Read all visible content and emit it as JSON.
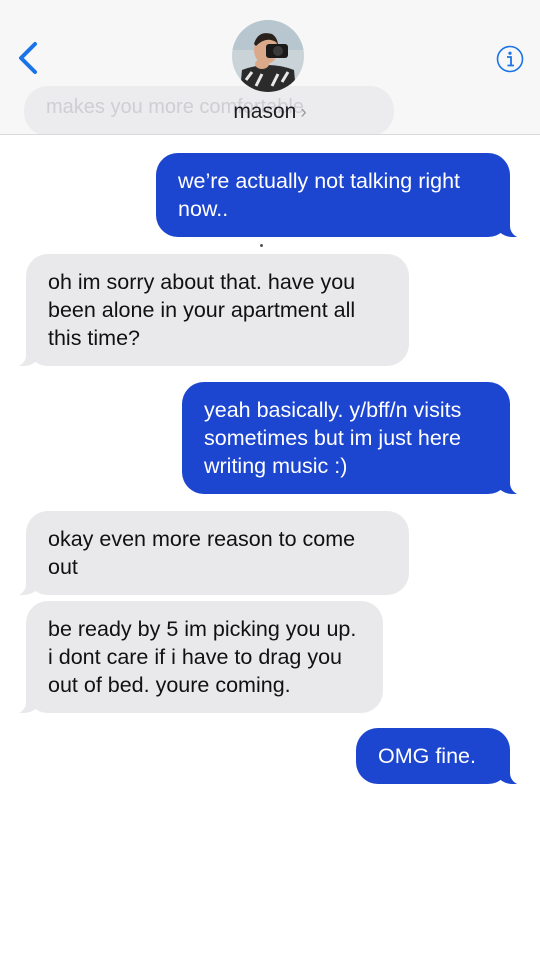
{
  "header": {
    "back_icon": "chevron-left-icon",
    "contact_name": "mason",
    "contact_chevron": "›",
    "info_icon": "info-circle-icon",
    "ghost_text": "makes you more comfortable",
    "accent_color": "#1a74e8"
  },
  "messages": [
    {
      "direction": "out",
      "text": "we’re actually not talking right now.."
    },
    {
      "direction": "in",
      "text": "oh im sorry about that. have you been alone in your apartment all this time?"
    },
    {
      "direction": "out",
      "text": "yeah basically. y/bff/n visits sometimes but im just here writing music :)"
    },
    {
      "direction": "in",
      "text": "okay even more reason to come out"
    },
    {
      "direction": "in",
      "text": "be ready by 5 im picking you up. i dont care if i have to drag you out of bed. youre coming."
    },
    {
      "direction": "out",
      "text": "OMG fine."
    }
  ],
  "colors": {
    "outgoing_bubble": "#1c45d0",
    "incoming_bubble": "#e9e9eb"
  }
}
